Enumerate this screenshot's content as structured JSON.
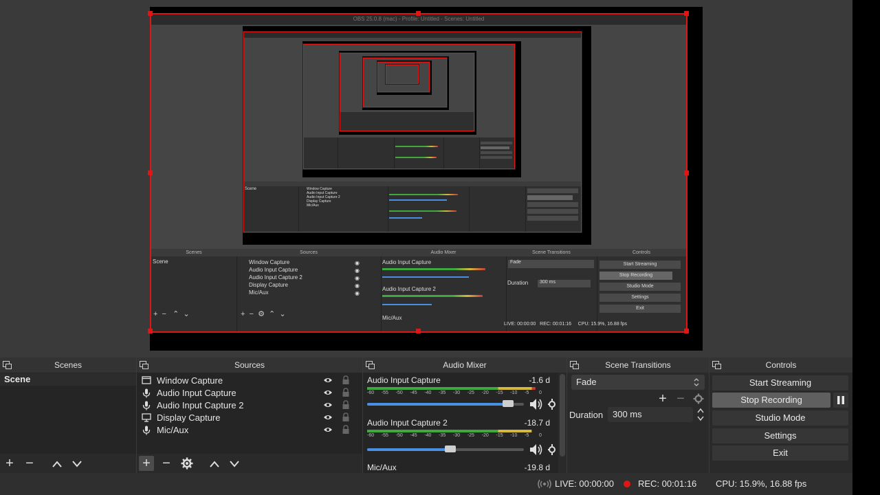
{
  "preview": {
    "titlebar_text": "OBS 25.0.8 (mac) - Profile: Untitled - Scenes: Untitled"
  },
  "docks": {
    "scenes": {
      "title": "Scenes",
      "items": [
        "Scene"
      ]
    },
    "sources": {
      "title": "Sources",
      "items": [
        {
          "label": "Window Capture",
          "icon": "window-icon"
        },
        {
          "label": "Audio Input Capture",
          "icon": "microphone-icon"
        },
        {
          "label": "Audio Input Capture 2",
          "icon": "microphone-icon"
        },
        {
          "label": "Display Capture",
          "icon": "monitor-icon"
        },
        {
          "label": "Mic/Aux",
          "icon": "microphone-icon"
        }
      ]
    },
    "mixer": {
      "title": "Audio Mixer",
      "ticks": [
        "-60",
        "-55",
        "-50",
        "-45",
        "-40",
        "-35",
        "-30",
        "-25",
        "-20",
        "-15",
        "-10",
        "-5",
        "0"
      ],
      "channels": [
        {
          "name": "Audio Input Capture",
          "db": "-1.6 d",
          "level": 0.9,
          "volume": 0.9
        },
        {
          "name": "Audio Input Capture 2",
          "db": "-18.7 d",
          "level": 0.88,
          "volume": 0.53
        },
        {
          "name": "Mic/Aux",
          "db": "-19.8 d"
        }
      ]
    },
    "transitions": {
      "title": "Scene Transitions",
      "selected": "Fade",
      "duration_label": "Duration",
      "duration_value": "300 ms"
    },
    "controls": {
      "title": "Controls",
      "start_streaming": "Start Streaming",
      "stop_recording": "Stop Recording",
      "studio_mode": "Studio Mode",
      "settings": "Settings",
      "exit": "Exit"
    }
  },
  "status": {
    "live": "LIVE: 00:00:00",
    "rec": "REC: 00:01:16",
    "cpu": "CPU: 15.9%, 16.88 fps"
  },
  "colors": {
    "selection_red": "#e01515",
    "meter_green": "#3fa83f",
    "meter_yellow": "#d4b93a",
    "meter_red": "#c83a3a",
    "volume_blue": "#4a90e2"
  }
}
